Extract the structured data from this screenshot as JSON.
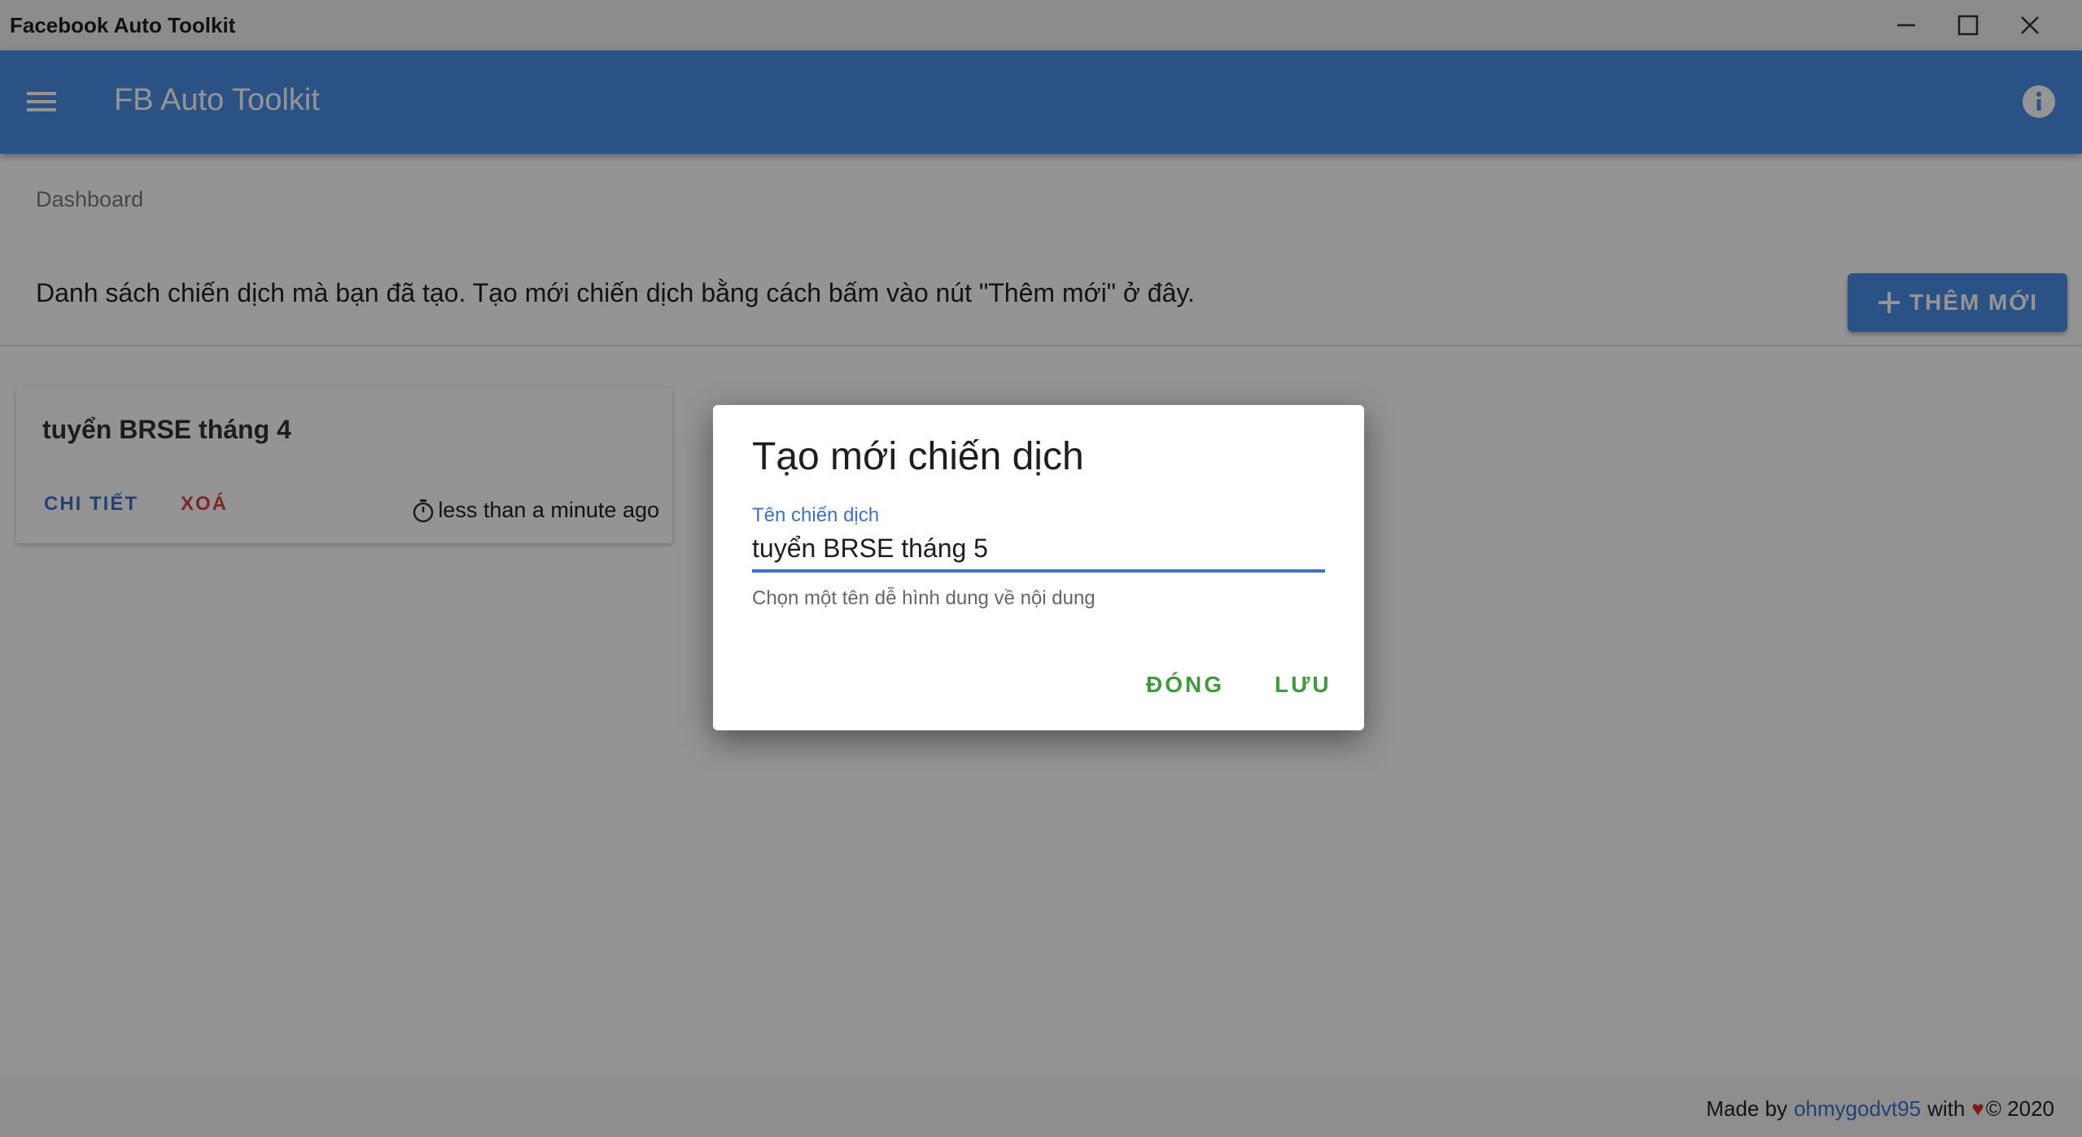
{
  "window": {
    "title": "Facebook Auto Toolkit",
    "controls": [
      "minimize-icon",
      "maximize-icon",
      "close-icon"
    ]
  },
  "appbar": {
    "menu_icon": "hamburger-menu-icon",
    "title": "FB Auto Toolkit",
    "info_icon": "info-icon",
    "color": "#4a8ee6"
  },
  "main": {
    "breadcrumb": "Dashboard",
    "description": "Danh sách chiến dịch mà bạn đã tạo. Tạo mới chiến dịch bằng cách bấm vào nút \"Thêm mới\" ở đây.",
    "add_button": "THÊM MỚI",
    "campaigns": [
      {
        "title": "tuyển BRSE tháng 4",
        "detail_label": "CHI TIẾT",
        "delete_label": "XOÁ",
        "time": "less than a minute ago"
      }
    ]
  },
  "footer": {
    "made_by": "Made by",
    "author": "ohmygodvt95",
    "with": "with",
    "heart": "♥",
    "copyright": "© 2020"
  },
  "dialog": {
    "title": "Tạo mới chiến dịch",
    "field_label": "Tên chiến dịch",
    "field_value": "tuyển BRSE tháng 5",
    "helper": "Chọn một tên dễ hình dung về nội dung",
    "close_label": "ĐÓNG",
    "save_label": "LƯU",
    "action_color": "#3e9c3e"
  }
}
